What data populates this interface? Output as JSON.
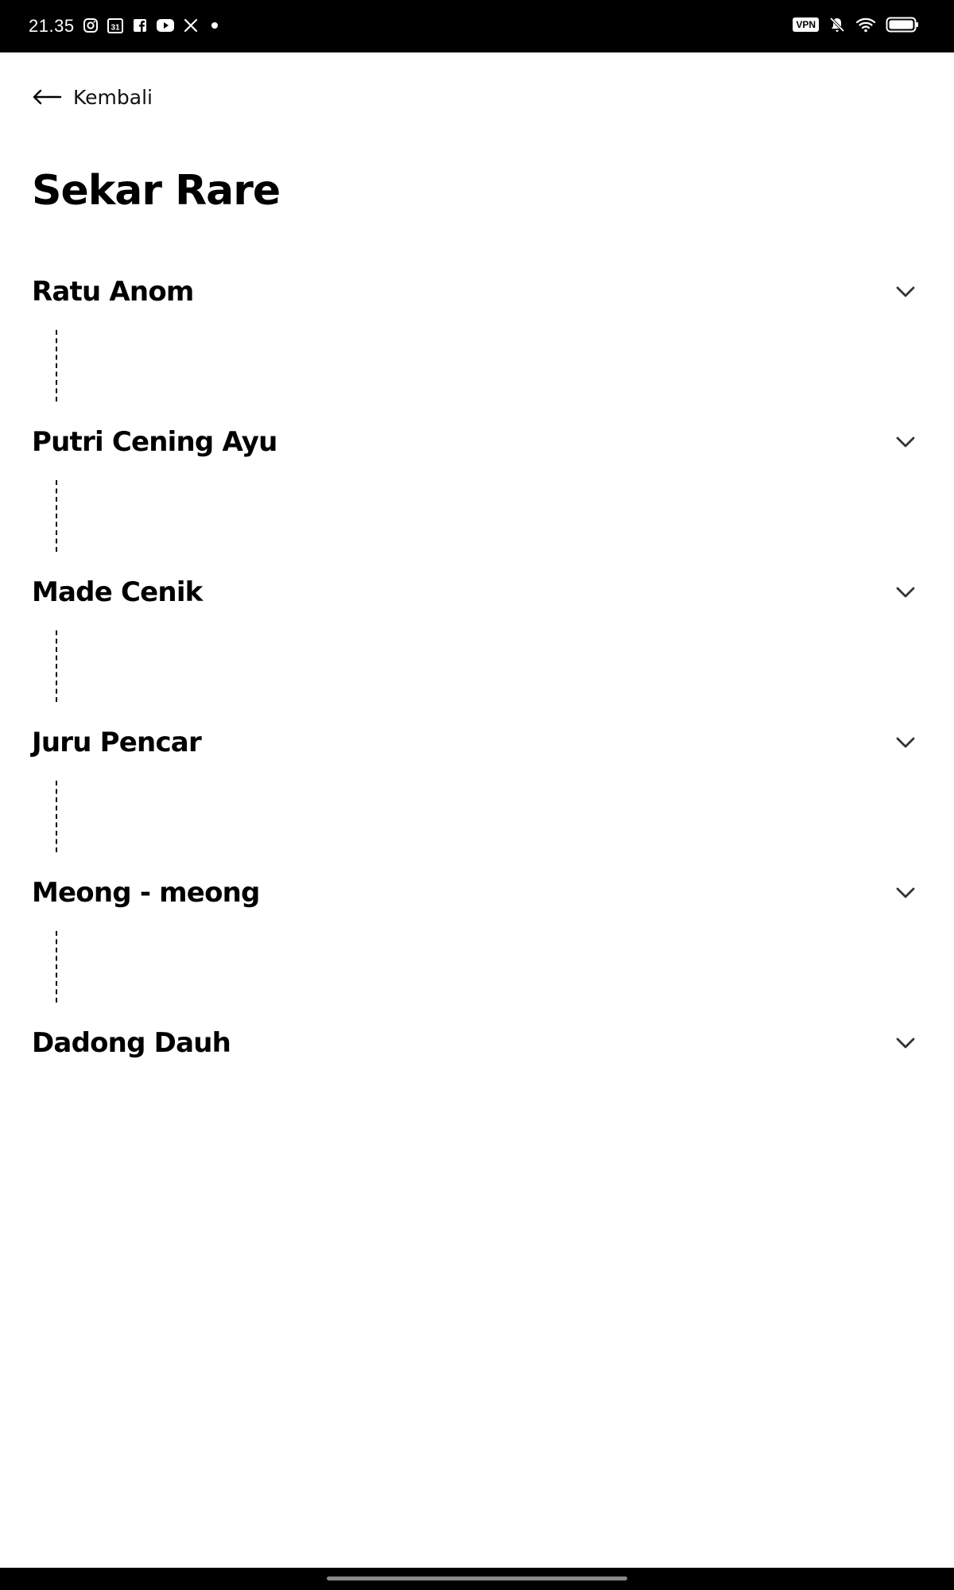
{
  "status_bar": {
    "time": "21.35",
    "left_icons": [
      "instagram-icon",
      "calendar-icon",
      "facebook-icon",
      "youtube-icon",
      "x-icon",
      "dot-icon"
    ],
    "calendar_day": "31",
    "vpn_label": "VPN",
    "right_icons": [
      "vpn-badge",
      "bell-muted-icon",
      "wifi-icon",
      "battery-icon"
    ]
  },
  "back": {
    "label": "Kembali",
    "icon": "arrow-left-icon"
  },
  "page": {
    "title": "Sekar Rare"
  },
  "songs": [
    {
      "title": "Ratu Anom"
    },
    {
      "title": "Putri Cening Ayu"
    },
    {
      "title": "Made Cenik"
    },
    {
      "title": "Juru Pencar"
    },
    {
      "title": "Meong - meong"
    },
    {
      "title": "Dadong Dauh"
    }
  ],
  "colors": {
    "background": "#ffffff",
    "text": "#000000",
    "chevron": "#333333",
    "status_bar": "#000000"
  }
}
